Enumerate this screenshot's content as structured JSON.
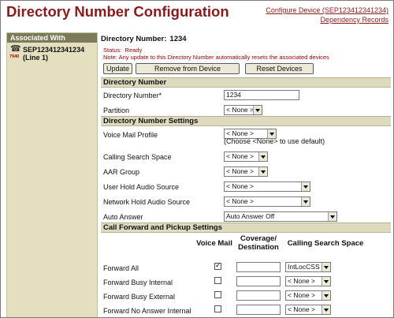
{
  "header": {
    "title": "Directory Number Configuration",
    "links": [
      "Configure Device (SEP123412341234)",
      "Dependency Records"
    ]
  },
  "associated": {
    "heading": "Associated With",
    "phone_model": "7940",
    "device_line": "SEP123412341234",
    "device_line2": "(Line 1)",
    "icon": "phone-icon"
  },
  "main": {
    "dn_label": "Directory Number:",
    "dn_value": "1234",
    "status_label": "Status:",
    "status_value": "Ready",
    "note": "Note: Any update to this Directory Number automatically resets the associated devices",
    "buttons": {
      "update": "Update",
      "remove": "Remove from Device",
      "reset": "Reset Devices"
    }
  },
  "section_dn": {
    "title": "Directory Number",
    "dn_field_label": "Directory Number*",
    "dn_field_value": "1234",
    "partition_label": "Partition",
    "partition_value": "< None >"
  },
  "section_settings": {
    "title": "Directory Number Settings",
    "voicemail_label": "Voice Mail Profile",
    "voicemail_value": "< None >",
    "voicemail_hint": "(Choose <None> to use default)",
    "css_label": "Calling Search Space",
    "css_value": "< None >",
    "aar_label": "AAR Group",
    "aar_value": "< None >",
    "uhold_label": "User Hold Audio Source",
    "uhold_value": "< None >",
    "nhold_label": "Network Hold Audio Source",
    "nhold_value": "< None >",
    "autoans_label": "Auto Answer",
    "autoans_value": "Auto Answer Off"
  },
  "section_cf": {
    "title": "Call Forward and Pickup Settings",
    "col_voicemail": "Voice Mail",
    "col_coverage_1": "Coverage/",
    "col_coverage_2": "Destination",
    "col_css": "Calling Search Space",
    "rows": [
      {
        "label": "Forward All",
        "checked": true,
        "css": "IntLocCSS"
      },
      {
        "label": "Forward Busy Internal",
        "checked": false,
        "css": "< None >"
      },
      {
        "label": "Forward Busy External",
        "checked": false,
        "css": "< None >"
      },
      {
        "label": "Forward No Answer Internal",
        "checked": false,
        "css": "< None >"
      }
    ]
  },
  "colors": {
    "title": "#8b1a1a",
    "section_bg": "#dedac0",
    "sidebar_bg": "#e4e0bf",
    "sidebar_head": "#7b7b59",
    "status": "#a00000"
  }
}
